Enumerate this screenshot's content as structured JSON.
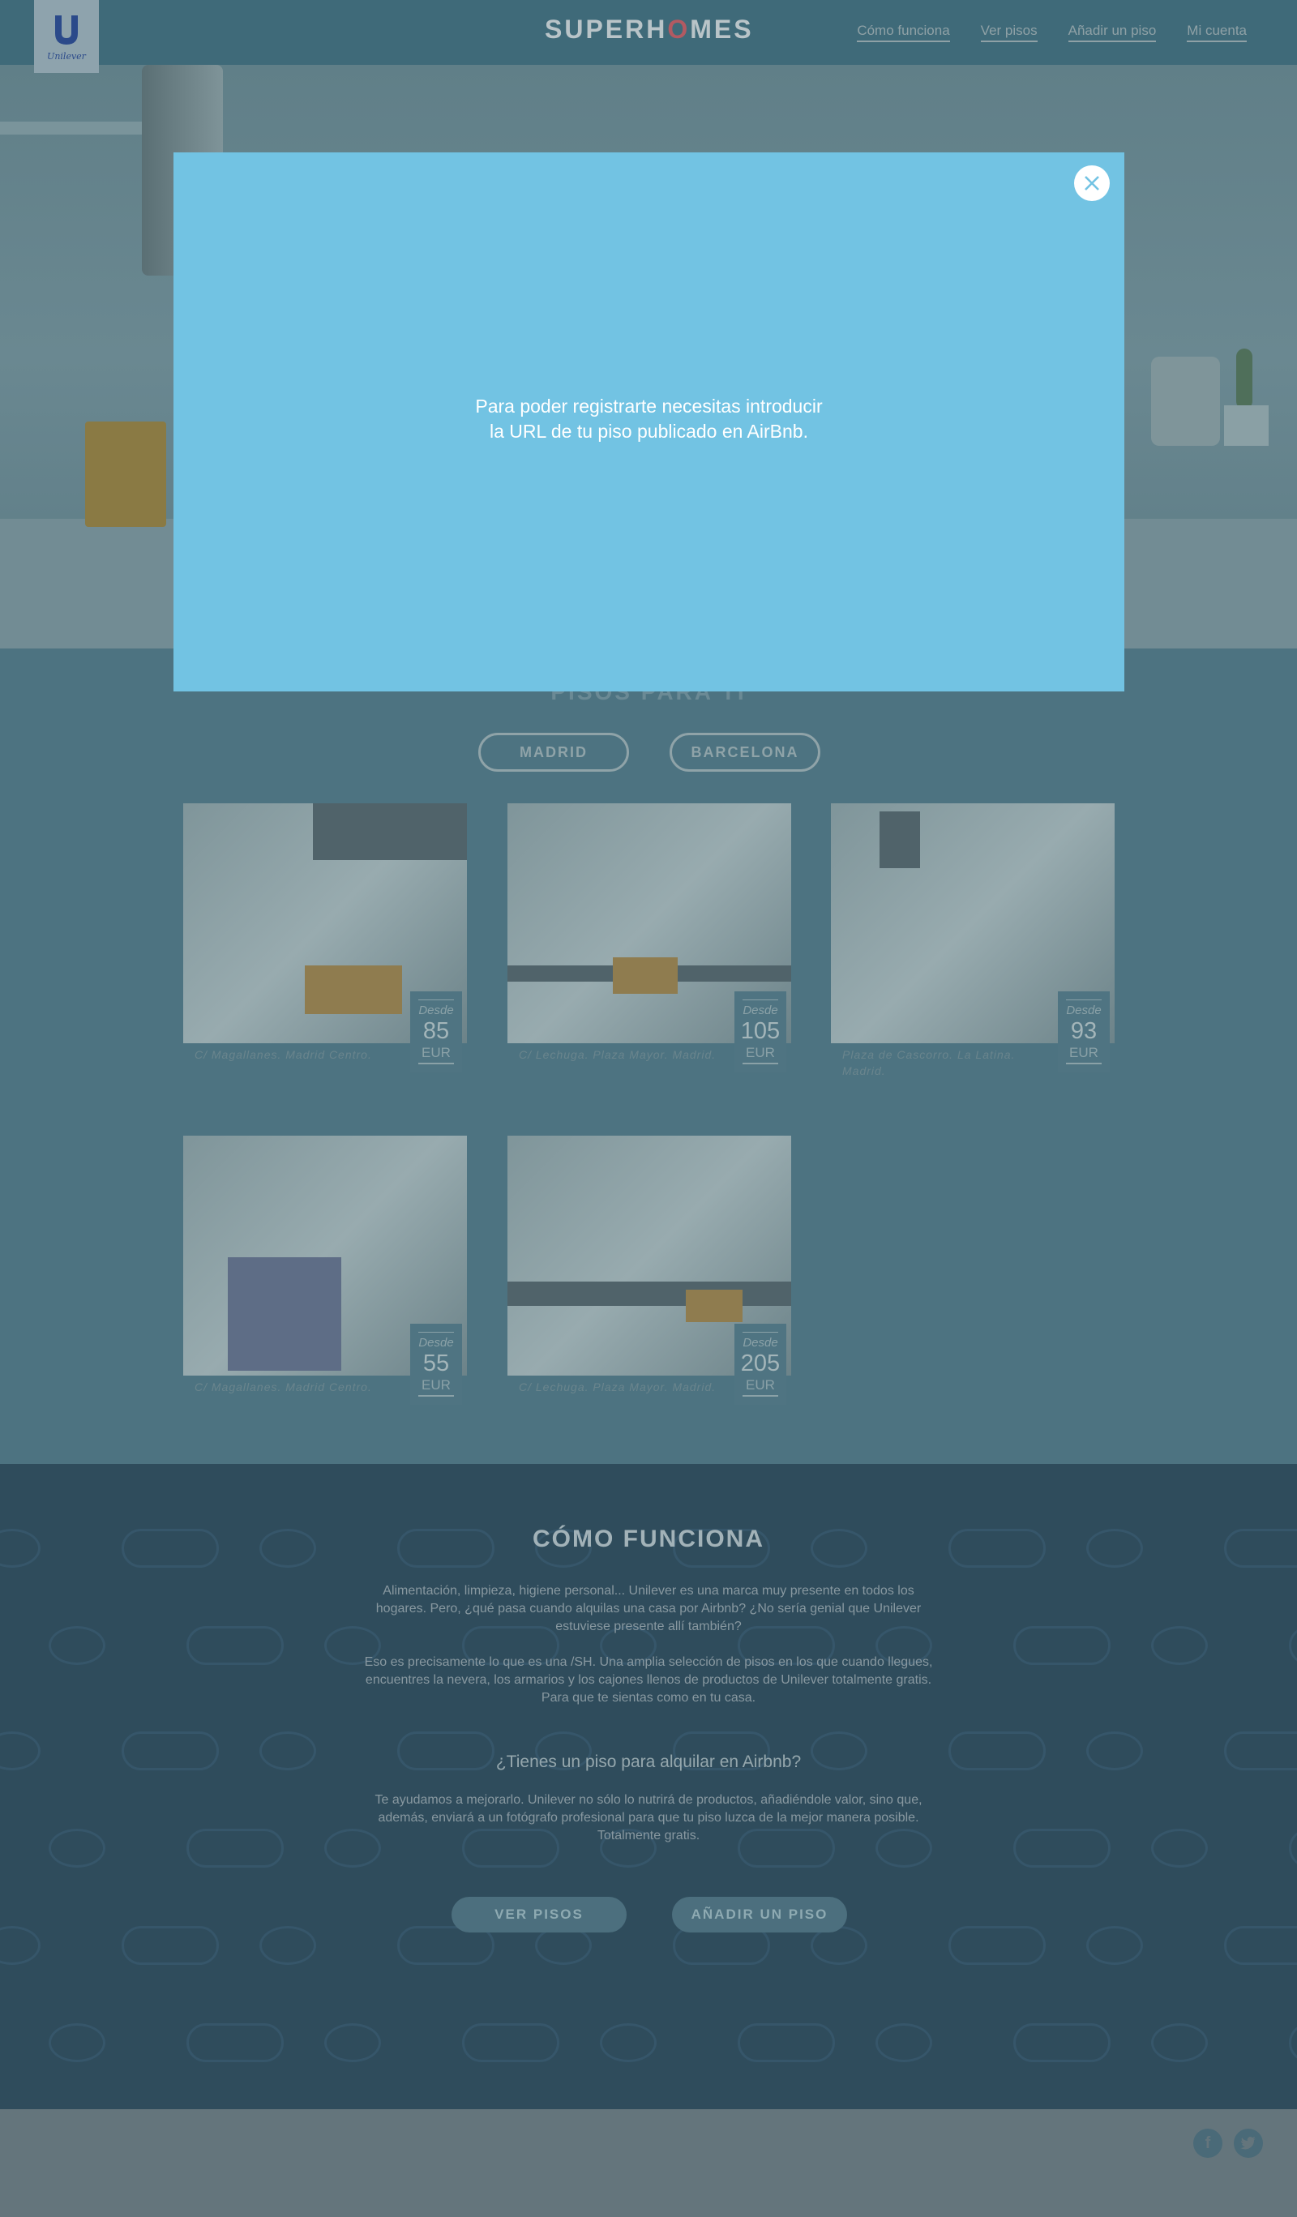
{
  "header": {
    "logo_text": "Unilever",
    "brand": "SUPERHOMES",
    "nav": [
      "Cómo funciona",
      "Ver pisos",
      "Añadir un piso",
      "Mi cuenta"
    ]
  },
  "modal": {
    "message_line1": "Para poder registrarte necesitas introducir",
    "message_line2": "la URL de tu piso publicado en AirBnb.",
    "close_icon": "close-icon"
  },
  "listings": {
    "title": "PISOS PARA TI",
    "cities": [
      "MADRID",
      "BARCELONA"
    ],
    "items": [
      {
        "address": "C/ Magallanes. Madrid Centro.",
        "desde": "Desde",
        "price": "85",
        "currency": "EUR"
      },
      {
        "address": "C/ Lechuga. Plaza Mayor. Madrid.",
        "desde": "Desde",
        "price": "105",
        "currency": "EUR"
      },
      {
        "address": "Plaza de Cascorro. La Latina. Madrid.",
        "desde": "Desde",
        "price": "93",
        "currency": "EUR"
      },
      {
        "address": "C/ Magallanes. Madrid Centro.",
        "desde": "Desde",
        "price": "55",
        "currency": "EUR"
      },
      {
        "address": "C/ Lechuga. Plaza Mayor. Madrid.",
        "desde": "Desde",
        "price": "205",
        "currency": "EUR"
      }
    ]
  },
  "how": {
    "title": "CÓMO FUNCIONA",
    "p1": "Alimentación, limpieza, higiene personal... Unilever es una marca muy presente en todos los hogares. Pero, ¿qué pasa cuando alquilas una casa por Airbnb? ¿No sería genial que Unilever estuviese presente allí también?",
    "p2": "Eso es precisamente lo que es una /SH. Una amplia selección de pisos en los que cuando llegues, encuentres la nevera, los armarios y los cajones llenos de productos de Unilever totalmente gratis. Para que te sientas como en tu casa.",
    "question": "¿Tienes un piso para alquilar en Airbnb?",
    "p3": "Te ayudamos a mejorarlo. Unilever no sólo lo nutrirá de productos, añadiéndole valor, sino que, además, enviará a un fotógrafo profesional para que tu piso luzca de la mejor manera posible. Totalmente gratis.",
    "btn_ver": "VER PISOS",
    "btn_add": "AÑADIR UN PISO"
  },
  "footer": {
    "social": [
      "facebook-icon",
      "twitter-icon"
    ]
  }
}
